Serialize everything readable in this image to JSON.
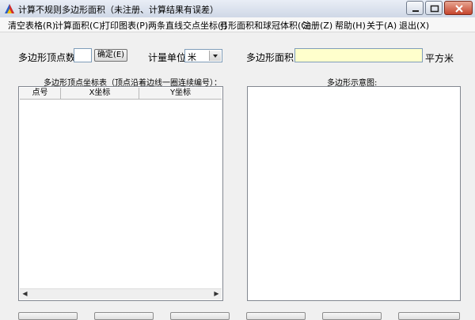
{
  "window": {
    "title": "计算不规则多边形面积（未注册、计算结果有误差）",
    "icon": "triangle-app-icon"
  },
  "menu": [
    {
      "label": "清空表格(R)"
    },
    {
      "label": "计算面积(C)"
    },
    {
      "label": "打印图表(P)"
    },
    {
      "label": "两条直线交点坐标(J)"
    },
    {
      "label": "弓形面积和球冠体积(G)"
    },
    {
      "label": "注册(Z)"
    },
    {
      "label": "帮助(H)"
    },
    {
      "label": "关于(A)"
    },
    {
      "label": "退出(X)"
    }
  ],
  "form": {
    "vertex_count_label": "多边形顶点数:",
    "vertex_count_value": "",
    "confirm_button": "确定(E)",
    "unit_label": "计量单位：",
    "unit_value": "米",
    "area_label": "多边形面积：",
    "area_value": "",
    "area_unit": "平方米",
    "area_field_color": "#ffffcc"
  },
  "table": {
    "caption": "多边形顶点坐标表（顶点沿着边线一圈连续编号）：",
    "columns": [
      "点号",
      "X坐标",
      "Y坐标"
    ],
    "rows": []
  },
  "preview": {
    "caption": "多边形示意图:"
  }
}
